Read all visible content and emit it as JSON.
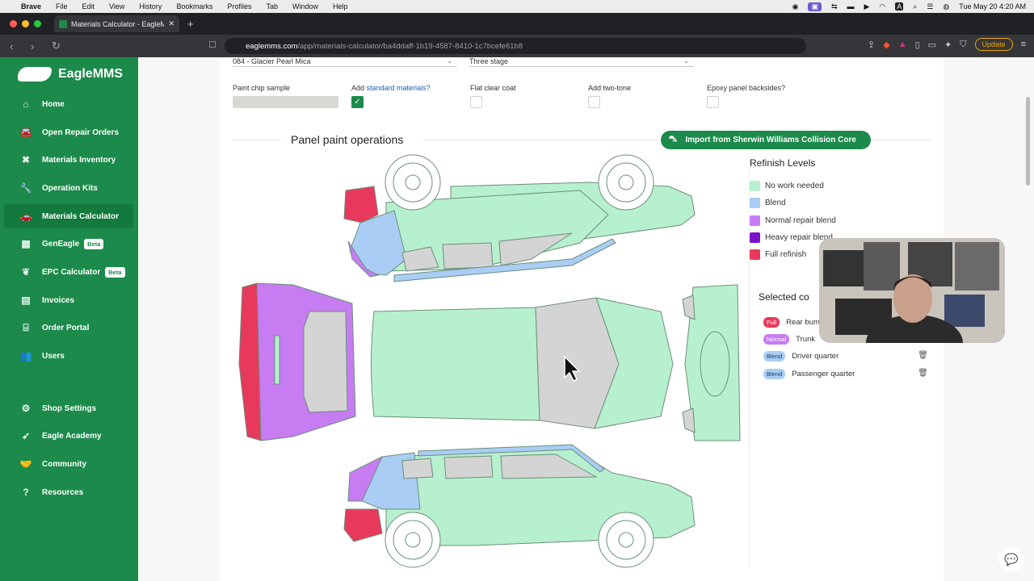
{
  "menubar": {
    "app": "Brave",
    "items": [
      "File",
      "Edit",
      "View",
      "History",
      "Bookmarks",
      "Profiles",
      "Tab",
      "Window",
      "Help"
    ],
    "datetime": "Tue May 20  4:20 AM"
  },
  "browser": {
    "tab_title": "Materials Calculator - EagleM",
    "url_host": "eaglemms.com",
    "url_path": "/app/materials-calculator/ba4ddaff-1b19-4587-8410-1c7bcefe61b8",
    "update_label": "Update"
  },
  "sidebar": {
    "brand": "EagleMMS",
    "items": [
      {
        "label": "Home"
      },
      {
        "label": "Open Repair Orders"
      },
      {
        "label": "Materials Inventory"
      },
      {
        "label": "Operation Kits"
      },
      {
        "label": "Materials Calculator"
      },
      {
        "label": "GenEagle",
        "badge": "Beta"
      },
      {
        "label": "EPC Calculator",
        "badge": "Beta"
      },
      {
        "label": "Invoices"
      },
      {
        "label": "Order Portal"
      },
      {
        "label": "Users"
      },
      {
        "label": "Shop Settings"
      },
      {
        "label": "Eagle Academy"
      },
      {
        "label": "Community"
      },
      {
        "label": "Resources"
      }
    ]
  },
  "form": {
    "color_value": "084 - Glacier Pearl Mica",
    "stage_value": "Three stage",
    "paint_chip_label": "Paint chip sample",
    "add_std_prefix": "Add ",
    "add_std_link": "standard materials?",
    "add_std_checked": true,
    "flat_clear_label": "Flat clear coat",
    "two_tone_label": "Add two-tone",
    "epoxy_label": "Epoxy panel backsides?"
  },
  "panel_ops": {
    "title": "Panel paint operations",
    "import_label": "Import from Sherwin Williams Collision Core"
  },
  "legend": {
    "title": "Refinish Levels",
    "items": [
      {
        "label": "No work needed",
        "color": "#b7f0cf"
      },
      {
        "label": "Blend",
        "color": "#a9cdf5"
      },
      {
        "label": "Normal repair blend",
        "color": "#c77cf2"
      },
      {
        "label": "Heavy repair blend",
        "color": "#7a12c9"
      },
      {
        "label": "Full refinish",
        "color": "#e8395c"
      }
    ]
  },
  "selected": {
    "title": "Selected co",
    "rows": [
      {
        "badge": "Full",
        "label": "Rear bum",
        "badge_bg": "#e8395c",
        "badge_fg": "#fff"
      },
      {
        "badge": "Normal",
        "label": "Trunk",
        "badge_bg": "#c77cf2",
        "badge_fg": "#fff"
      },
      {
        "badge": "Blend",
        "label": "Driver quarter",
        "badge_bg": "#a9cdf5",
        "badge_fg": "#1a3d66"
      },
      {
        "badge": "Blend",
        "label": "Passenger quarter",
        "badge_bg": "#a9cdf5",
        "badge_fg": "#1a3d66"
      }
    ]
  },
  "colors": {
    "brand_green": "#1b8a4a",
    "no_work": "#b7f0cf",
    "blend": "#a9cdf5",
    "normal": "#c77cf2",
    "full": "#e8395c",
    "selected_grey": "#d4d4d4"
  }
}
